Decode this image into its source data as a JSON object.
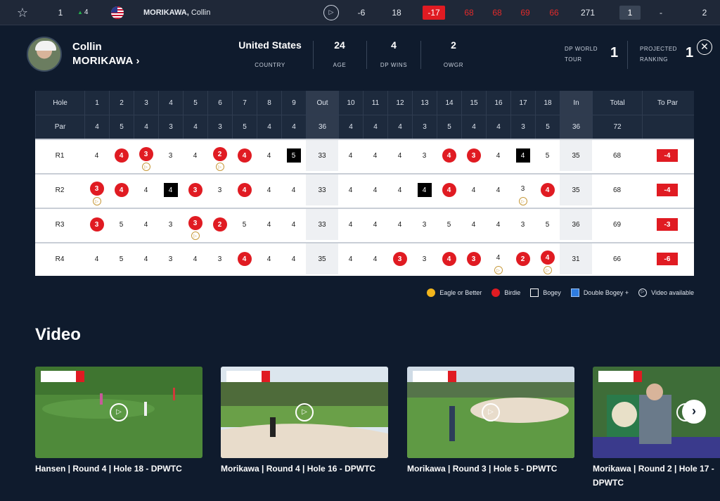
{
  "top_row": {
    "position": "1",
    "movement": "4",
    "player": {
      "last": "MORIKAWA,",
      "first": "Collin"
    },
    "today": "-6",
    "thru": "18",
    "to_par": "-17",
    "r1": "68",
    "r2": "68",
    "r3": "69",
    "r4": "66",
    "total": "271",
    "col_a": "1",
    "col_b": "-",
    "col_c": "2"
  },
  "player": {
    "first_name": "Collin",
    "last_name": "MORIKAWA ›",
    "stats": [
      {
        "value": "United States",
        "label": "COUNTRY"
      },
      {
        "value": "24",
        "label": "AGE"
      },
      {
        "value": "4",
        "label": "DP WINS"
      },
      {
        "value": "2",
        "label": "OWGR"
      }
    ],
    "rankings": [
      {
        "label_1": "DP WORLD",
        "label_2": "TOUR",
        "value": "1"
      },
      {
        "label_1": "PROJECTED",
        "label_2": "RANKING",
        "value": "1"
      }
    ]
  },
  "scorecard": {
    "header": [
      "Hole",
      "1",
      "2",
      "3",
      "4",
      "5",
      "6",
      "7",
      "8",
      "9",
      "Out",
      "10",
      "11",
      "12",
      "13",
      "14",
      "15",
      "16",
      "17",
      "18",
      "In",
      "Total",
      "To Par"
    ],
    "par": [
      "Par",
      "4",
      "5",
      "4",
      "3",
      "4",
      "3",
      "5",
      "4",
      "4",
      "36",
      "4",
      "4",
      "4",
      "3",
      "5",
      "4",
      "4",
      "3",
      "5",
      "36",
      "72",
      ""
    ],
    "rounds": [
      {
        "label": "R1",
        "scores": [
          "4",
          "4",
          "3",
          "3",
          "4",
          "2",
          "4",
          "4",
          "5",
          "33",
          "4",
          "4",
          "4",
          "3",
          "4",
          "3",
          "4",
          "4",
          "5",
          "35",
          "68",
          "-4"
        ],
        "types": [
          "",
          "b",
          "b",
          "",
          "",
          "b",
          "b",
          "",
          "g",
          "",
          "",
          "",
          "",
          "",
          "b",
          "b",
          "",
          "g",
          "",
          "",
          "",
          ""
        ],
        "videos": [
          false,
          false,
          true,
          false,
          false,
          true,
          false,
          false,
          false,
          false,
          false,
          false,
          false,
          false,
          false,
          false,
          false,
          false,
          false,
          false,
          false,
          false
        ]
      },
      {
        "label": "R2",
        "scores": [
          "3",
          "4",
          "4",
          "4",
          "3",
          "3",
          "4",
          "4",
          "4",
          "33",
          "4",
          "4",
          "4",
          "4",
          "4",
          "4",
          "4",
          "3",
          "4",
          "35",
          "68",
          "-4"
        ],
        "types": [
          "b",
          "b",
          "",
          "g",
          "b",
          "",
          "b",
          "",
          "",
          "",
          "",
          "",
          "",
          "g",
          "b",
          "",
          "",
          "",
          "b",
          "",
          "",
          ""
        ],
        "videos": [
          true,
          false,
          false,
          false,
          false,
          false,
          false,
          false,
          false,
          false,
          false,
          false,
          false,
          false,
          false,
          false,
          false,
          true,
          false,
          false,
          false,
          false
        ]
      },
      {
        "label": "R3",
        "scores": [
          "3",
          "5",
          "4",
          "3",
          "3",
          "2",
          "5",
          "4",
          "4",
          "33",
          "4",
          "4",
          "4",
          "3",
          "5",
          "4",
          "4",
          "3",
          "5",
          "36",
          "69",
          "-3"
        ],
        "types": [
          "b",
          "",
          "",
          "",
          "b",
          "b",
          "",
          "",
          "",
          "",
          "",
          "",
          "",
          "",
          "",
          "",
          "",
          "",
          "",
          "",
          "",
          ""
        ],
        "videos": [
          false,
          false,
          false,
          false,
          true,
          false,
          false,
          false,
          false,
          false,
          false,
          false,
          false,
          false,
          false,
          false,
          false,
          false,
          false,
          false,
          false,
          false
        ]
      },
      {
        "label": "R4",
        "scores": [
          "4",
          "5",
          "4",
          "3",
          "4",
          "3",
          "4",
          "4",
          "4",
          "35",
          "4",
          "4",
          "3",
          "3",
          "4",
          "3",
          "4",
          "2",
          "4",
          "31",
          "66",
          "-6"
        ],
        "types": [
          "",
          "",
          "",
          "",
          "",
          "",
          "b",
          "",
          "",
          "",
          "",
          "",
          "b",
          "",
          "b",
          "b",
          "",
          "b",
          "b",
          "",
          "",
          ""
        ],
        "videos": [
          false,
          false,
          false,
          false,
          false,
          false,
          false,
          false,
          false,
          false,
          false,
          false,
          false,
          false,
          false,
          false,
          true,
          false,
          true,
          false,
          false,
          false
        ]
      }
    ]
  },
  "legend": {
    "eagle": "Eagle or Better",
    "birdie": "Birdie",
    "bogey": "Bogey",
    "double_bogey": "Double Bogey +",
    "video": "Video available"
  },
  "video_section": {
    "title": "Video",
    "items": [
      {
        "title": "Hansen | Round 4 | Hole 18 - DPWTC"
      },
      {
        "title": "Morikawa | Round 4 | Hole 16 - DPWTC"
      },
      {
        "title": "Morikawa | Round 3 | Hole 5 - DPWTC"
      },
      {
        "title": "Morikawa | Round 2 | Hole 17 - DPWTC"
      }
    ]
  },
  "icons": {
    "star": "☆",
    "movement": "▲",
    "play": "▷",
    "close": "✕",
    "next": "›"
  }
}
